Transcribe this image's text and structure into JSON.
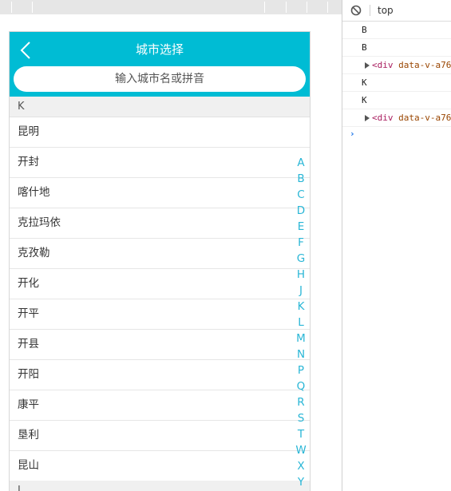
{
  "app": {
    "title": "城市选择",
    "search_placeholder": "输入城市名或拼音",
    "current_section": "K",
    "next_section": "L",
    "cities": [
      "昆明",
      "开封",
      "喀什地",
      "克拉玛依",
      "克孜勒",
      "开化",
      "开平",
      "开县",
      "开阳",
      "康平",
      "垦利",
      "昆山"
    ],
    "index_letters": [
      "A",
      "B",
      "C",
      "D",
      "E",
      "F",
      "G",
      "H",
      "J",
      "K",
      "L",
      "M",
      "N",
      "P",
      "Q",
      "R",
      "S",
      "T",
      "W",
      "X",
      "Y"
    ],
    "colors": {
      "header": "#00bcd4",
      "index": "#29b6d6"
    }
  },
  "devtools": {
    "context": "top",
    "logs": [
      {
        "type": "text",
        "text": "B"
      },
      {
        "type": "text",
        "text": "B"
      },
      {
        "type": "element",
        "tag": "<div",
        "attr": "data-v-a76"
      },
      {
        "type": "text",
        "text": "K"
      },
      {
        "type": "text",
        "text": "K"
      },
      {
        "type": "element",
        "tag": "<div",
        "attr": "data-v-a76"
      }
    ],
    "prompt_symbol": "›"
  }
}
